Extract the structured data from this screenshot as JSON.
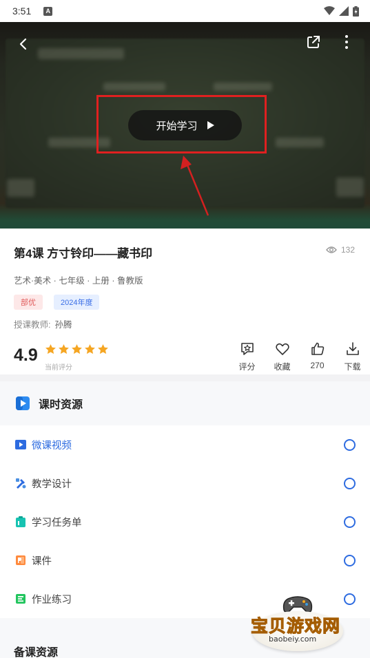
{
  "status_bar": {
    "time": "3:51",
    "notification_badge": "A",
    "icons": [
      "wifi-icon",
      "signal-icon",
      "battery-icon"
    ]
  },
  "video": {
    "start_label": "开始学习",
    "icons": [
      "back-icon",
      "share-icon",
      "more-icon",
      "play-icon"
    ]
  },
  "lesson": {
    "title": "第4课 方寸铃印——藏书印",
    "views": "132",
    "subject_line": "艺术·美术 · 七年级 · 上册 · 鲁教版",
    "tags": [
      "部优",
      "2024年度"
    ],
    "teacher_label": "授课教师:",
    "teacher_name": "孙腾",
    "score": "4.9",
    "stars": 5,
    "score_label": "当前评分"
  },
  "actions": [
    {
      "label": "评分",
      "icon": "rate-icon"
    },
    {
      "label": "收藏",
      "icon": "heart-icon"
    },
    {
      "label": "270",
      "icon": "thumbs-up-icon"
    },
    {
      "label": "下载",
      "icon": "download-icon"
    }
  ],
  "resources": {
    "header": "课时资源",
    "items": [
      {
        "label": "微课视频",
        "icon": "video-icon",
        "active": true
      },
      {
        "label": "教学设计",
        "icon": "design-icon",
        "active": false
      },
      {
        "label": "学习任务单",
        "icon": "task-list-icon",
        "active": false
      },
      {
        "label": "课件",
        "icon": "slides-icon",
        "active": false
      },
      {
        "label": "作业练习",
        "icon": "exercise-icon",
        "active": false
      }
    ]
  },
  "prep_resources": {
    "header": "备课资源"
  },
  "watermark": {
    "title": "宝贝游戏网",
    "url": "baobeiy.com"
  },
  "colors": {
    "accent": "#2d6be0",
    "star": "#f5a623",
    "highlight": "#e02020"
  }
}
